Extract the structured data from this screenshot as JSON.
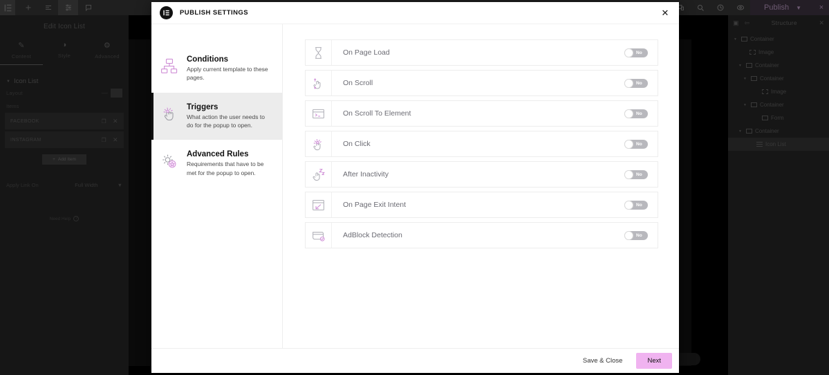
{
  "topbar": {
    "logo_icon": "elementor-logo-icon",
    "icons": [
      "plus-icon",
      "layers-icon",
      "settings-sliders-icon",
      "comment-icon"
    ],
    "right_icons": [
      "responsive-icon",
      "search-icon",
      "history-icon",
      "preview-eye-icon"
    ],
    "publish_label": "Publish",
    "publish_chevron": "chevron-down-icon",
    "close_label": "×"
  },
  "left_panel": {
    "title": "Edit Icon List",
    "tabs": [
      {
        "label": "Content",
        "icon": "pencil-icon",
        "active": true
      },
      {
        "label": "Style",
        "icon": "contrast-icon",
        "active": false
      },
      {
        "label": "Advanced",
        "icon": "gear-icon",
        "active": false
      }
    ],
    "section_title": "Icon List",
    "layout_label": "Layout",
    "items_label": "Items",
    "items": [
      {
        "name": "FACEBOOK",
        "duplicate_icon": "duplicate-icon",
        "remove_icon": "close-icon"
      },
      {
        "name": "INSTAGRAM",
        "duplicate_icon": "duplicate-icon",
        "remove_icon": "close-icon"
      }
    ],
    "add_item_label": "Add Item",
    "apply_link_label": "Apply Link On",
    "apply_link_value": "Full Width",
    "need_help_label": "Need Help",
    "collapse_icon": "chevron-left-icon"
  },
  "navigator": {
    "title": "Structure",
    "dock_icon": "dock-icon",
    "pin_icon": "pin-icon",
    "close_icon": "close-icon",
    "tree": [
      {
        "label": "Container",
        "depth": 0,
        "type": "container",
        "expanded": true,
        "selected": false
      },
      {
        "label": "Image",
        "depth": 1,
        "type": "image",
        "expanded": null,
        "selected": false
      },
      {
        "label": "Container",
        "depth": 1,
        "type": "container",
        "expanded": true,
        "selected": false
      },
      {
        "label": "Container",
        "depth": 2,
        "type": "container",
        "expanded": true,
        "selected": false
      },
      {
        "label": "Image",
        "depth": 3,
        "type": "image",
        "expanded": null,
        "selected": false
      },
      {
        "label": "Container",
        "depth": 2,
        "type": "container",
        "expanded": true,
        "selected": false
      },
      {
        "label": "Form",
        "depth": 3,
        "type": "form",
        "expanded": null,
        "selected": false
      },
      {
        "label": "Container",
        "depth": 1,
        "type": "container",
        "expanded": true,
        "selected": false
      },
      {
        "label": "Icon List",
        "depth": 2,
        "type": "iconlist",
        "expanded": null,
        "selected": true
      }
    ]
  },
  "modal": {
    "title": "PUBLISH SETTINGS",
    "logo_icon": "elementor-logo-icon",
    "close_icon": "close-icon",
    "nav": [
      {
        "title": "Conditions",
        "desc": "Apply current template to these pages.",
        "icon": "sitemap-icon",
        "active": false
      },
      {
        "title": "Triggers",
        "desc": "What action the user needs to do for the popup to open.",
        "icon": "click-hand-icon",
        "active": true
      },
      {
        "title": "Advanced Rules",
        "desc": "Requirements that have to be met for the popup to open.",
        "icon": "gear-star-icon",
        "active": false
      }
    ],
    "triggers": [
      {
        "label": "On Page Load",
        "icon": "hourglass-icon",
        "value": "No",
        "enabled": false
      },
      {
        "label": "On Scroll",
        "icon": "scroll-hand-icon",
        "value": "No",
        "enabled": false
      },
      {
        "label": "On Scroll To Element",
        "icon": "terminal-icon",
        "value": "No",
        "enabled": false
      },
      {
        "label": "On Click",
        "icon": "click-hand-icon",
        "value": "No",
        "enabled": false
      },
      {
        "label": "After Inactivity",
        "icon": "sleeping-hand-icon",
        "value": "No",
        "enabled": false
      },
      {
        "label": "On Page Exit Intent",
        "icon": "exit-arrow-icon",
        "value": "No",
        "enabled": false
      },
      {
        "label": "AdBlock Detection",
        "icon": "adblock-icon",
        "value": "No",
        "enabled": false
      }
    ],
    "footer": {
      "save_label": "Save & Close",
      "next_label": "Next"
    }
  },
  "colors": {
    "accent_pink": "#f0b3f0",
    "icon_purple": "#cf8fd6",
    "modal_bg": "#ffffff",
    "active_nav_bg": "#ececec"
  }
}
